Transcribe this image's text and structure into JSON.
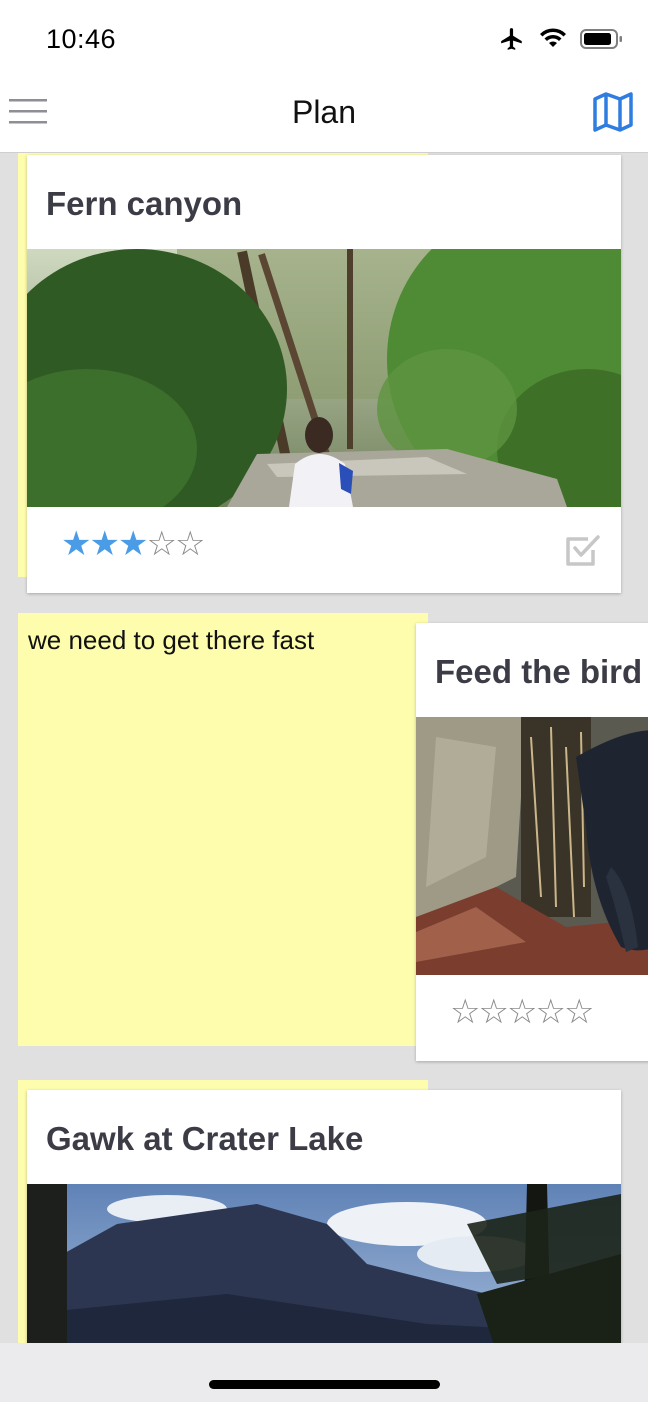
{
  "status": {
    "time": "10:46"
  },
  "nav": {
    "title": "Plan"
  },
  "cards": [
    {
      "title": "Fern canyon",
      "rating": 3,
      "max_rating": 5,
      "stars_text": "★★★☆☆"
    },
    {
      "title": "Feed the bird",
      "rating": 0,
      "max_rating": 5,
      "stars_text": "☆☆☆☆☆"
    },
    {
      "title": "Gawk at Crater Lake"
    }
  ],
  "note": {
    "text": "we need to get there fast"
  },
  "colors": {
    "accent": "#4a9ce6",
    "note_yellow": "#fdfdad",
    "map_icon": "#2f7de1"
  }
}
